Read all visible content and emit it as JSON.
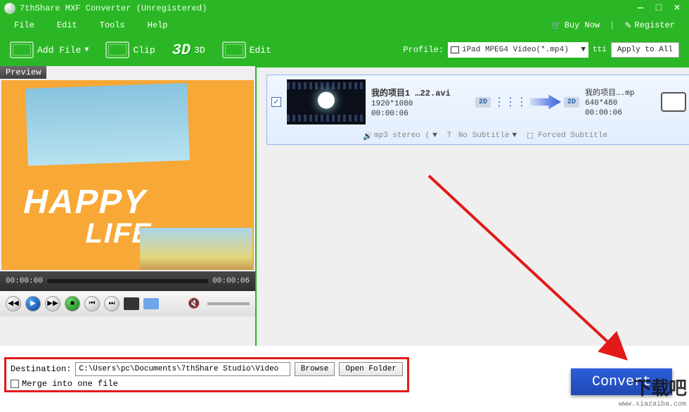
{
  "window": {
    "title": "7thShare MXF Converter (Unregistered)",
    "minimize": "—",
    "maximize": "□",
    "close": "×"
  },
  "menu": {
    "file": "File",
    "edit": "Edit",
    "tools": "Tools",
    "help": "Help",
    "buynow": "Buy Now",
    "register": "Register"
  },
  "toolbar": {
    "add_file": "Add File",
    "add_dd": "▼",
    "clip": "Clip",
    "threeD_logo": "3D",
    "threeD": "3D",
    "edit": "Edit",
    "profile_label": "Profile:",
    "profile_value": "iPad MPEG4 Video(*.mp4)",
    "profile_dd": "▼",
    "tti": "tti",
    "apply_all": "Apply to All"
  },
  "preview": {
    "label": "Preview",
    "happy": "HAPPY",
    "life": "LIFE",
    "time_start": "00:00:00",
    "time_end": "00:00:06"
  },
  "file_item": {
    "check": "✓",
    "src_name": "我的项目1 …22.avi",
    "src_res": "1920*1080",
    "src_dur": "00:00:06",
    "badge_2d_1": "2D",
    "badge_2d_2": "2D",
    "out_name": "我的项目….mp",
    "out_res": "640*480",
    "out_dur": "00:00:06",
    "audio": "mp3 stereo (",
    "audio_dd": "▼",
    "subtitle": "No Subtitle",
    "subtitle_dd": "▼",
    "forced": "Forced Subtitle"
  },
  "destination": {
    "label": "Destination:",
    "path": "C:\\Users\\pc\\Documents\\7thShare Studio\\Video",
    "browse": "Browse",
    "open_folder": "Open Folder",
    "merge": "Merge into one file"
  },
  "convert": "Convert",
  "watermark": {
    "big": "下载吧",
    "url": "www.xiazaiba.com"
  }
}
